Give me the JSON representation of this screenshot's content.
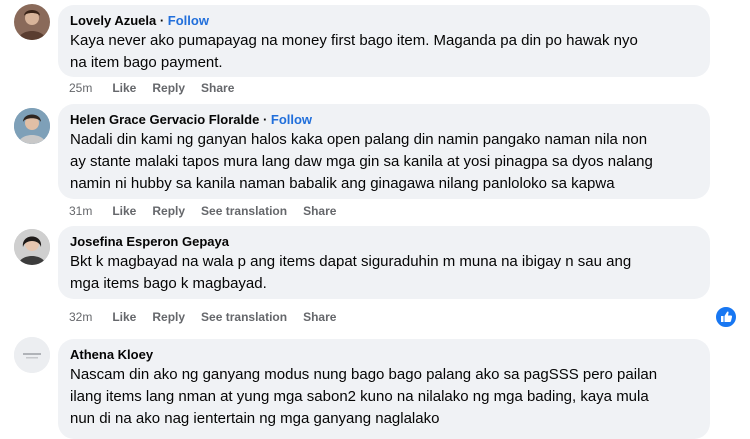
{
  "comments": [
    {
      "author": "Lovely Azuela",
      "follow": "Follow",
      "lines": [
        "Kaya never ako pumapayag na money first bago item. Maganda pa din po hawak nyo",
        "na item bago payment."
      ],
      "time": "25m",
      "like": "Like",
      "reply": "Reply",
      "share": "Share"
    },
    {
      "author": "Helen Grace Gervacio Floralde",
      "follow": "Follow",
      "lines": [
        "Nadali din kami ng ganyan halos kaka open palang din namin pangako naman nila non",
        "ay stante malaki tapos mura lang daw mga gin sa kanila at yosi pinagpa sa dyos nalang",
        "namin ni hubby sa kanila naman babalik ang ginagawa nilang panloloko sa kapwa"
      ],
      "time": "31m",
      "like": "Like",
      "reply": "Reply",
      "see_translation": "See translation",
      "share": "Share"
    },
    {
      "author": "Josefina Esperon Gepaya",
      "lines": [
        "Bkt k magbayad na wala p ang items dapat siguraduhin m muna na ibigay n sau ang",
        "mga items bago k magbayad."
      ],
      "time": "32m",
      "like": "Like",
      "reply": "Reply",
      "see_translation": "See translation",
      "share": "Share",
      "reaction": "like-icon"
    },
    {
      "author": "Athena Kloey",
      "lines": [
        "Nascam din ako ng ganyang modus nung bago bago palang ako sa pagSSS pero pailan",
        "ilang items lang nman at yung mga sabon2 kuno na nilalako ng mga bading, kaya mula",
        "nun di na ako nag ientertain ng mga ganyang naglalako"
      ]
    }
  ],
  "colors": {
    "bubble": "#f0f2f5",
    "follow": "#216fdb",
    "meta": "#65676b",
    "like_badge": "#1877f2"
  }
}
